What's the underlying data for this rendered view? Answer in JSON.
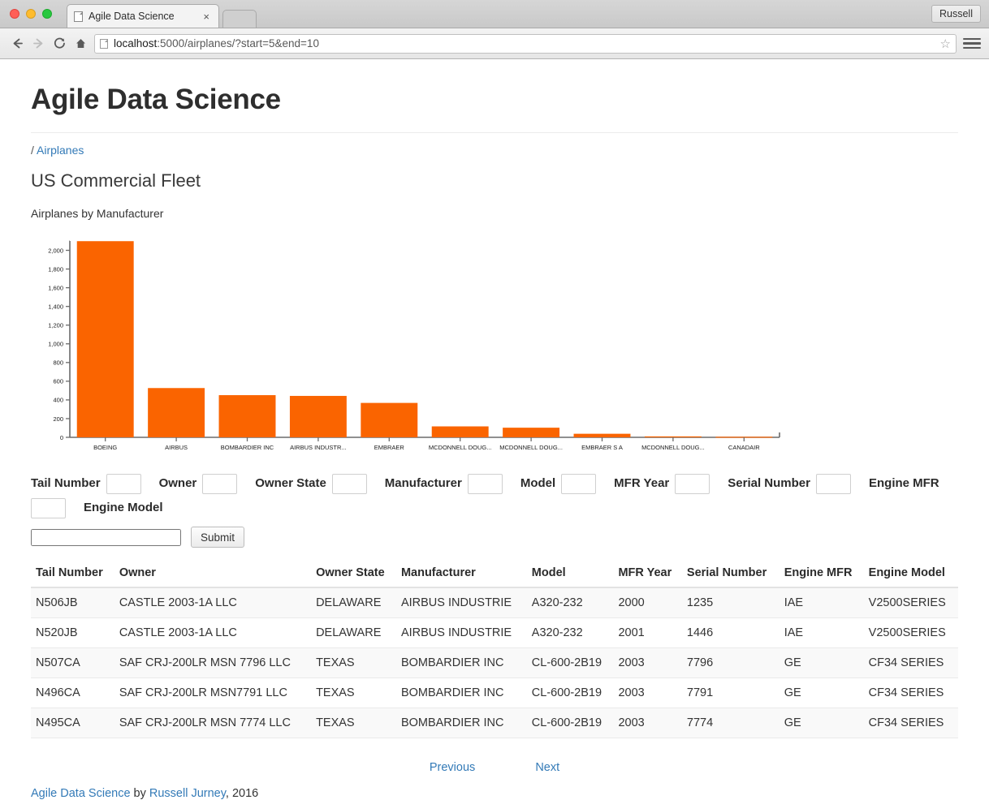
{
  "browser": {
    "tab_title": "Agile Data Science",
    "tab_close_glyph": "×",
    "profile_label": "Russell",
    "back_glyph": "←",
    "forward_glyph": "→",
    "reload_glyph": "C",
    "home_glyph": "⌂",
    "star_glyph": "☆",
    "url_prefix": "localhost",
    "url_rest": ":5000/airplanes/?start=5&end=10"
  },
  "page": {
    "brand": "Agile Data Science",
    "breadcrumb_sep": "/",
    "breadcrumb_link": "Airplanes",
    "subtitle": "US Commercial Fleet",
    "chart_caption": "Airplanes by Manufacturer",
    "accent_color": "#fa6400",
    "link_color": "#337ab7"
  },
  "chart_data": {
    "type": "bar",
    "title": "Airplanes by Manufacturer",
    "xlabel": "",
    "ylabel": "",
    "ylim": [
      0,
      2100
    ],
    "grid": false,
    "legend": null,
    "ytick_labels": [
      "0",
      "200",
      "400",
      "600",
      "800",
      "1,000",
      "1,200",
      "1,400",
      "1,600",
      "1,800",
      "2,000"
    ],
    "ytick_values": [
      0,
      200,
      400,
      600,
      800,
      1000,
      1200,
      1400,
      1600,
      1800,
      2000
    ],
    "categories": [
      "BOEING",
      "AIRBUS",
      "BOMBARDIER INC",
      "AIRBUS INDUSTR...",
      "EMBRAER",
      "MCDONNELL DOUG...",
      "MCDONNELL DOUG...",
      "EMBRAER S A",
      "MCDONNELL DOUG...",
      "CANADAIR"
    ],
    "values": [
      2098,
      527,
      451,
      443,
      368,
      117,
      103,
      38,
      10,
      6
    ]
  },
  "filter_form": {
    "fields": [
      {
        "label": "Tail Number",
        "value": "",
        "name": "tail-number"
      },
      {
        "label": "Owner",
        "value": "",
        "name": "owner"
      },
      {
        "label": "Owner State",
        "value": "",
        "name": "owner-state"
      },
      {
        "label": "Manufacturer",
        "value": "",
        "name": "manufacturer"
      },
      {
        "label": "Model",
        "value": "",
        "name": "model"
      },
      {
        "label": "MFR Year",
        "value": "",
        "name": "mfr-year"
      },
      {
        "label": "Serial Number",
        "value": "",
        "name": "serial-number"
      },
      {
        "label": "Engine MFR",
        "value": "",
        "name": "engine-mfr"
      },
      {
        "label": "Engine Model",
        "value": "",
        "name": "engine-model"
      }
    ],
    "submit_label": "Submit"
  },
  "table": {
    "columns": [
      "Tail Number",
      "Owner",
      "Owner State",
      "Manufacturer",
      "Model",
      "MFR Year",
      "Serial Number",
      "Engine MFR",
      "Engine Model"
    ],
    "rows": [
      [
        "N506JB",
        "CASTLE 2003-1A LLC",
        "DELAWARE",
        "AIRBUS INDUSTRIE",
        "A320-232",
        "2000",
        "1235",
        "IAE",
        "V2500SERIES"
      ],
      [
        "N520JB",
        "CASTLE 2003-1A LLC",
        "DELAWARE",
        "AIRBUS INDUSTRIE",
        "A320-232",
        "2001",
        "1446",
        "IAE",
        "V2500SERIES"
      ],
      [
        "N507CA",
        "SAF CRJ-200LR MSN 7796 LLC",
        "TEXAS",
        "BOMBARDIER INC",
        "CL-600-2B19",
        "2003",
        "7796",
        "GE",
        "CF34 SERIES"
      ],
      [
        "N496CA",
        "SAF CRJ-200LR MSN7791 LLC",
        "TEXAS",
        "BOMBARDIER INC",
        "CL-600-2B19",
        "2003",
        "7791",
        "GE",
        "CF34 SERIES"
      ],
      [
        "N495CA",
        "SAF CRJ-200LR MSN 7774 LLC",
        "TEXAS",
        "BOMBARDIER INC",
        "CL-600-2B19",
        "2003",
        "7774",
        "GE",
        "CF34 SERIES"
      ]
    ]
  },
  "pager": {
    "previous": "Previous",
    "next": "Next"
  },
  "footer": {
    "link1": "Agile Data Science",
    "mid": " by ",
    "link2": "Russell Jurney",
    "tail": ", 2016"
  }
}
